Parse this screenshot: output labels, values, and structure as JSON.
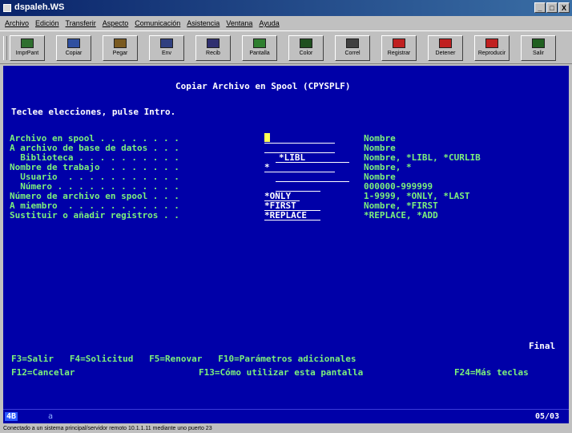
{
  "window": {
    "title": "dspaleh.WS",
    "controls": [
      "_",
      "□",
      "X"
    ]
  },
  "menu": [
    "Archivo",
    "Edición",
    "Transferir",
    "Aspecto",
    "Comunicación",
    "Asistencia",
    "Ventana",
    "Ayuda"
  ],
  "toolbar": [
    {
      "label": "ImprPant",
      "icon": "printer-icon",
      "color": "#2f6f2f"
    },
    {
      "label": "Copiar",
      "icon": "copy-icon",
      "color": "#3050a0"
    },
    {
      "label": "Pegar",
      "icon": "paste-icon",
      "color": "#7a5a20"
    },
    {
      "label": "Env",
      "icon": "send-icon",
      "color": "#304080"
    },
    {
      "label": "Recib",
      "icon": "receive-icon",
      "color": "#303070"
    },
    {
      "label": "Pantalla",
      "icon": "display-icon",
      "color": "#2f7f2f"
    },
    {
      "label": "Color",
      "icon": "color-icon",
      "color": "#205020"
    },
    {
      "label": "Correl",
      "icon": "map-icon",
      "color": "#404040"
    },
    {
      "label": "Registrar",
      "icon": "record-macro-icon",
      "color": "#c02020"
    },
    {
      "label": "Detener",
      "icon": "stop-icon",
      "color": "#c02020"
    },
    {
      "label": "Reproducir",
      "icon": "play-macro-icon",
      "color": "#c02020"
    },
    {
      "label": "Salir",
      "icon": "exit-icon",
      "color": "#206020"
    }
  ],
  "screen": {
    "title": "Copiar Archivo en Spool (CPYSPLF)",
    "instruction": "Teclee elecciones, pulse Intro.",
    "fields": [
      {
        "label": "Archivo en spool . . . . . . . .",
        "value": "",
        "help": "Nombre"
      },
      {
        "label": "A archivo de base de datos . . .",
        "value": "",
        "help": "Nombre"
      },
      {
        "label": "  Biblioteca . . . . . . . . . .",
        "value": "*LIBL",
        "help": "Nombre, *LIBL, *CURLIB"
      },
      {
        "label": "Nombre de trabajo  . . . . . . .",
        "value": "*",
        "help": "Nombre, *"
      },
      {
        "label": "  Usuario  . . . . . . . . . . .",
        "value": "",
        "help": "Nombre"
      },
      {
        "label": "  Número . . . . . . . . . . . .",
        "value": "",
        "help": "000000-999999"
      },
      {
        "label": "Número de archivo en spool . . .",
        "value": "*ONLY",
        "help": "1-9999, *ONLY, *LAST"
      },
      {
        "label": "A miembro  . . . . . . . . . . .",
        "value": "*FIRST",
        "help": "Nombre, *FIRST"
      },
      {
        "label": "Sustituir o añadir registros . .",
        "value": "*REPLACE",
        "help": "*REPLACE, *ADD"
      }
    ],
    "more": "Final",
    "fkeys_line1": "F3=Salir   F4=Solicitud   F5=Renovar   F10=Parámetros adicionales",
    "fkeys_line2_left": "F12=Cancelar",
    "fkeys_line2_mid": "F13=Cómo utilizar esta pantalla",
    "fkeys_line2_right": "F24=Más teclas"
  },
  "oia": {
    "session": "4B",
    "indicator": "a",
    "cursor_pos": "05/03"
  },
  "statusbar": "Conectado a un sistema principal/servidor remoto 10.1.1.11 mediante uno puerto 23"
}
